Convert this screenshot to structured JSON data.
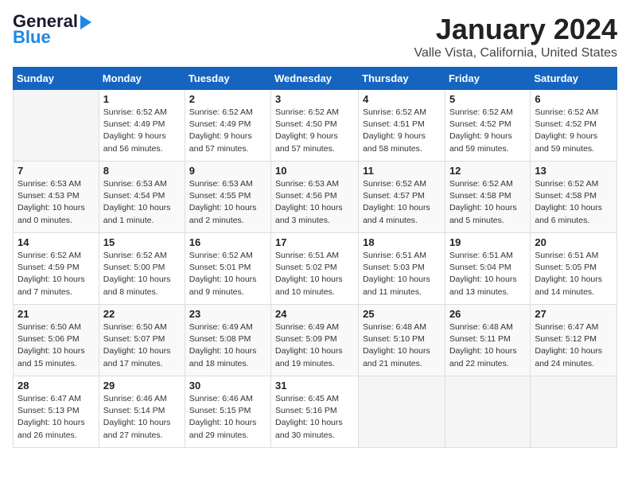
{
  "logo": {
    "line1": "General",
    "line2": "Blue"
  },
  "title": "January 2024",
  "subtitle": "Valle Vista, California, United States",
  "headers": [
    "Sunday",
    "Monday",
    "Tuesday",
    "Wednesday",
    "Thursday",
    "Friday",
    "Saturday"
  ],
  "weeks": [
    [
      {
        "num": "",
        "info": ""
      },
      {
        "num": "1",
        "info": "Sunrise: 6:52 AM\nSunset: 4:49 PM\nDaylight: 9 hours\nand 56 minutes."
      },
      {
        "num": "2",
        "info": "Sunrise: 6:52 AM\nSunset: 4:49 PM\nDaylight: 9 hours\nand 57 minutes."
      },
      {
        "num": "3",
        "info": "Sunrise: 6:52 AM\nSunset: 4:50 PM\nDaylight: 9 hours\nand 57 minutes."
      },
      {
        "num": "4",
        "info": "Sunrise: 6:52 AM\nSunset: 4:51 PM\nDaylight: 9 hours\nand 58 minutes."
      },
      {
        "num": "5",
        "info": "Sunrise: 6:52 AM\nSunset: 4:52 PM\nDaylight: 9 hours\nand 59 minutes."
      },
      {
        "num": "6",
        "info": "Sunrise: 6:52 AM\nSunset: 4:52 PM\nDaylight: 9 hours\nand 59 minutes."
      }
    ],
    [
      {
        "num": "7",
        "info": "Sunrise: 6:53 AM\nSunset: 4:53 PM\nDaylight: 10 hours\nand 0 minutes."
      },
      {
        "num": "8",
        "info": "Sunrise: 6:53 AM\nSunset: 4:54 PM\nDaylight: 10 hours\nand 1 minute."
      },
      {
        "num": "9",
        "info": "Sunrise: 6:53 AM\nSunset: 4:55 PM\nDaylight: 10 hours\nand 2 minutes."
      },
      {
        "num": "10",
        "info": "Sunrise: 6:53 AM\nSunset: 4:56 PM\nDaylight: 10 hours\nand 3 minutes."
      },
      {
        "num": "11",
        "info": "Sunrise: 6:52 AM\nSunset: 4:57 PM\nDaylight: 10 hours\nand 4 minutes."
      },
      {
        "num": "12",
        "info": "Sunrise: 6:52 AM\nSunset: 4:58 PM\nDaylight: 10 hours\nand 5 minutes."
      },
      {
        "num": "13",
        "info": "Sunrise: 6:52 AM\nSunset: 4:58 PM\nDaylight: 10 hours\nand 6 minutes."
      }
    ],
    [
      {
        "num": "14",
        "info": "Sunrise: 6:52 AM\nSunset: 4:59 PM\nDaylight: 10 hours\nand 7 minutes."
      },
      {
        "num": "15",
        "info": "Sunrise: 6:52 AM\nSunset: 5:00 PM\nDaylight: 10 hours\nand 8 minutes."
      },
      {
        "num": "16",
        "info": "Sunrise: 6:52 AM\nSunset: 5:01 PM\nDaylight: 10 hours\nand 9 minutes."
      },
      {
        "num": "17",
        "info": "Sunrise: 6:51 AM\nSunset: 5:02 PM\nDaylight: 10 hours\nand 10 minutes."
      },
      {
        "num": "18",
        "info": "Sunrise: 6:51 AM\nSunset: 5:03 PM\nDaylight: 10 hours\nand 11 minutes."
      },
      {
        "num": "19",
        "info": "Sunrise: 6:51 AM\nSunset: 5:04 PM\nDaylight: 10 hours\nand 13 minutes."
      },
      {
        "num": "20",
        "info": "Sunrise: 6:51 AM\nSunset: 5:05 PM\nDaylight: 10 hours\nand 14 minutes."
      }
    ],
    [
      {
        "num": "21",
        "info": "Sunrise: 6:50 AM\nSunset: 5:06 PM\nDaylight: 10 hours\nand 15 minutes."
      },
      {
        "num": "22",
        "info": "Sunrise: 6:50 AM\nSunset: 5:07 PM\nDaylight: 10 hours\nand 17 minutes."
      },
      {
        "num": "23",
        "info": "Sunrise: 6:49 AM\nSunset: 5:08 PM\nDaylight: 10 hours\nand 18 minutes."
      },
      {
        "num": "24",
        "info": "Sunrise: 6:49 AM\nSunset: 5:09 PM\nDaylight: 10 hours\nand 19 minutes."
      },
      {
        "num": "25",
        "info": "Sunrise: 6:48 AM\nSunset: 5:10 PM\nDaylight: 10 hours\nand 21 minutes."
      },
      {
        "num": "26",
        "info": "Sunrise: 6:48 AM\nSunset: 5:11 PM\nDaylight: 10 hours\nand 22 minutes."
      },
      {
        "num": "27",
        "info": "Sunrise: 6:47 AM\nSunset: 5:12 PM\nDaylight: 10 hours\nand 24 minutes."
      }
    ],
    [
      {
        "num": "28",
        "info": "Sunrise: 6:47 AM\nSunset: 5:13 PM\nDaylight: 10 hours\nand 26 minutes."
      },
      {
        "num": "29",
        "info": "Sunrise: 6:46 AM\nSunset: 5:14 PM\nDaylight: 10 hours\nand 27 minutes."
      },
      {
        "num": "30",
        "info": "Sunrise: 6:46 AM\nSunset: 5:15 PM\nDaylight: 10 hours\nand 29 minutes."
      },
      {
        "num": "31",
        "info": "Sunrise: 6:45 AM\nSunset: 5:16 PM\nDaylight: 10 hours\nand 30 minutes."
      },
      {
        "num": "",
        "info": ""
      },
      {
        "num": "",
        "info": ""
      },
      {
        "num": "",
        "info": ""
      }
    ]
  ]
}
